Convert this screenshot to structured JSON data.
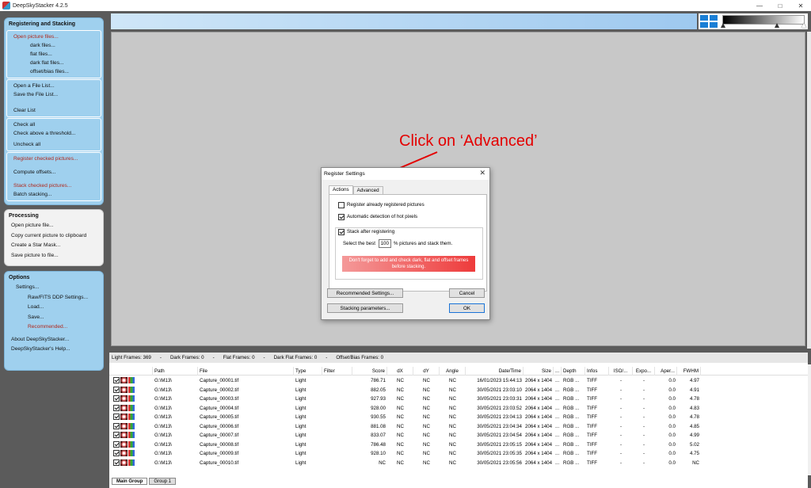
{
  "window": {
    "title": "DeepSkyStacker 4.2.5",
    "min": "—",
    "max": "□",
    "close": "✕"
  },
  "sidebar": {
    "registering": {
      "title": "Registering and Stacking",
      "open_items": [
        {
          "label": "Open picture files...",
          "red": true,
          "indent": 0
        },
        {
          "label": "dark files...",
          "red": false,
          "indent": 2
        },
        {
          "label": "flat files...",
          "red": false,
          "indent": 2
        },
        {
          "label": "dark flat files...",
          "red": false,
          "indent": 2
        },
        {
          "label": "offset/bias files...",
          "red": false,
          "indent": 2
        }
      ],
      "list_items": [
        "Open a File List...",
        "Save the File List...",
        "Clear List"
      ],
      "check_items": [
        "Check all",
        "Check above a threshold...",
        "Uncheck all"
      ],
      "action_items": [
        {
          "label": "Register checked pictures...",
          "red": true
        },
        {
          "label": "Compute offsets...",
          "red": false
        },
        {
          "label": "Stack checked pictures...",
          "red": true
        },
        {
          "label": "Batch stacking...",
          "red": false
        }
      ]
    },
    "processing": {
      "title": "Processing",
      "items": [
        "Open picture file...",
        "Copy current picture to clipboard",
        "Create a Star Mask...",
        "Save picture to file..."
      ]
    },
    "options": {
      "title": "Options",
      "items": [
        {
          "label": "Settings...",
          "indent": 1,
          "red": false
        },
        {
          "label": "Raw/FITS DDP Settings...",
          "indent": 2,
          "red": false
        },
        {
          "label": "Load...",
          "indent": 2,
          "red": false
        },
        {
          "label": "Save...",
          "indent": 2,
          "red": false
        },
        {
          "label": "Recommended...",
          "indent": 2,
          "red": true
        },
        {
          "label": "About DeepSkyStacker...",
          "indent": 0,
          "red": false
        },
        {
          "label": "DeepSkyStacker's Help...",
          "indent": 0,
          "red": false
        }
      ]
    }
  },
  "annotation": {
    "text": "Click on ‘Advanced’",
    "color": "#e40000"
  },
  "dialog": {
    "title": "Register Settings",
    "close": "✕",
    "tabs": [
      "Actions",
      "Advanced"
    ],
    "register_already": {
      "label": "Register already registered pictures",
      "checked": false
    },
    "hot_pixels": {
      "label": "Automatic detection of hot pixels",
      "checked": true
    },
    "stack_after": {
      "label": "Stack after registering",
      "checked": true
    },
    "select_best_prefix": "Select the best",
    "select_best_value": "100",
    "select_best_suffix": "% pictures and stack them.",
    "warning_line1": "Don't forget to add and check dark, flat and offset frames",
    "warning_line2": "before stacking.",
    "buttons": {
      "recommended": "Recommended Settings...",
      "cancel": "Cancel",
      "stacking": "Stacking parameters...",
      "ok": "OK"
    }
  },
  "counts": {
    "light": "Light Frames: 369",
    "dark": "Dark Frames: 0",
    "flat": "Flat Frames: 0",
    "darkflat": "Dark Flat Frames: 0",
    "offset": "Offset/Bias Frames: 0",
    "sep": "-"
  },
  "table": {
    "headers": [
      "Path",
      "File",
      "Type",
      "Filter",
      "Score",
      "dX",
      "dY",
      "Angle",
      "Date/Time",
      "Size",
      "...",
      "Depth",
      "Infos",
      "ISO/...",
      "Expo...",
      "Aper...",
      "FWHM"
    ],
    "rows": [
      [
        "G:\\M13\\",
        "Capture_00001.tif",
        "Light",
        "",
        "786.71",
        "NC",
        "NC",
        "NC",
        "16/01/2023 15:44:13",
        "2064 x 1404",
        "...",
        "RGB ...",
        "TIFF",
        "-",
        "-",
        "0.0",
        "4.97"
      ],
      [
        "G:\\M13\\",
        "Capture_00002.tif",
        "Light",
        "",
        "882.05",
        "NC",
        "NC",
        "NC",
        "30/05/2021 23:03:10",
        "2064 x 1404",
        "...",
        "RGB ...",
        "TIFF",
        "-",
        "-",
        "0.0",
        "4.91"
      ],
      [
        "G:\\M13\\",
        "Capture_00003.tif",
        "Light",
        "",
        "927.93",
        "NC",
        "NC",
        "NC",
        "30/05/2021 23:03:31",
        "2064 x 1404",
        "...",
        "RGB ...",
        "TIFF",
        "-",
        "-",
        "0.0",
        "4.78"
      ],
      [
        "G:\\M13\\",
        "Capture_00004.tif",
        "Light",
        "",
        "928.00",
        "NC",
        "NC",
        "NC",
        "30/05/2021 23:03:52",
        "2064 x 1404",
        "...",
        "RGB ...",
        "TIFF",
        "-",
        "-",
        "0.0",
        "4.83"
      ],
      [
        "G:\\M13\\",
        "Capture_00005.tif",
        "Light",
        "",
        "930.55",
        "NC",
        "NC",
        "NC",
        "30/05/2021 23:04:13",
        "2064 x 1404",
        "...",
        "RGB ...",
        "TIFF",
        "-",
        "-",
        "0.0",
        "4.78"
      ],
      [
        "G:\\M13\\",
        "Capture_00006.tif",
        "Light",
        "",
        "881.08",
        "NC",
        "NC",
        "NC",
        "30/05/2021 23:04:34",
        "2064 x 1404",
        "...",
        "RGB ...",
        "TIFF",
        "-",
        "-",
        "0.0",
        "4.85"
      ],
      [
        "G:\\M13\\",
        "Capture_00007.tif",
        "Light",
        "",
        "833.07",
        "NC",
        "NC",
        "NC",
        "30/05/2021 23:04:54",
        "2064 x 1404",
        "...",
        "RGB ...",
        "TIFF",
        "-",
        "-",
        "0.0",
        "4.99"
      ],
      [
        "G:\\M13\\",
        "Capture_00008.tif",
        "Light",
        "",
        "786.48",
        "NC",
        "NC",
        "NC",
        "30/05/2021 23:05:15",
        "2064 x 1404",
        "...",
        "RGB ...",
        "TIFF",
        "-",
        "-",
        "0.0",
        "5.02"
      ],
      [
        "G:\\M13\\",
        "Capture_00009.tif",
        "Light",
        "",
        "928.10",
        "NC",
        "NC",
        "NC",
        "30/05/2021 23:05:35",
        "2064 x 1404",
        "...",
        "RGB ...",
        "TIFF",
        "-",
        "-",
        "0.0",
        "4.75"
      ],
      [
        "G:\\M13\\",
        "Capture_00010.tif",
        "Light",
        "",
        "NC",
        "NC",
        "NC",
        "NC",
        "30/05/2021 23:05:56",
        "2064 x 1404",
        "...",
        "RGB ...",
        "TIFF",
        "-",
        "-",
        "0.0",
        "NC"
      ]
    ]
  },
  "bottom_tabs": [
    "Main Group",
    "Group 1"
  ]
}
